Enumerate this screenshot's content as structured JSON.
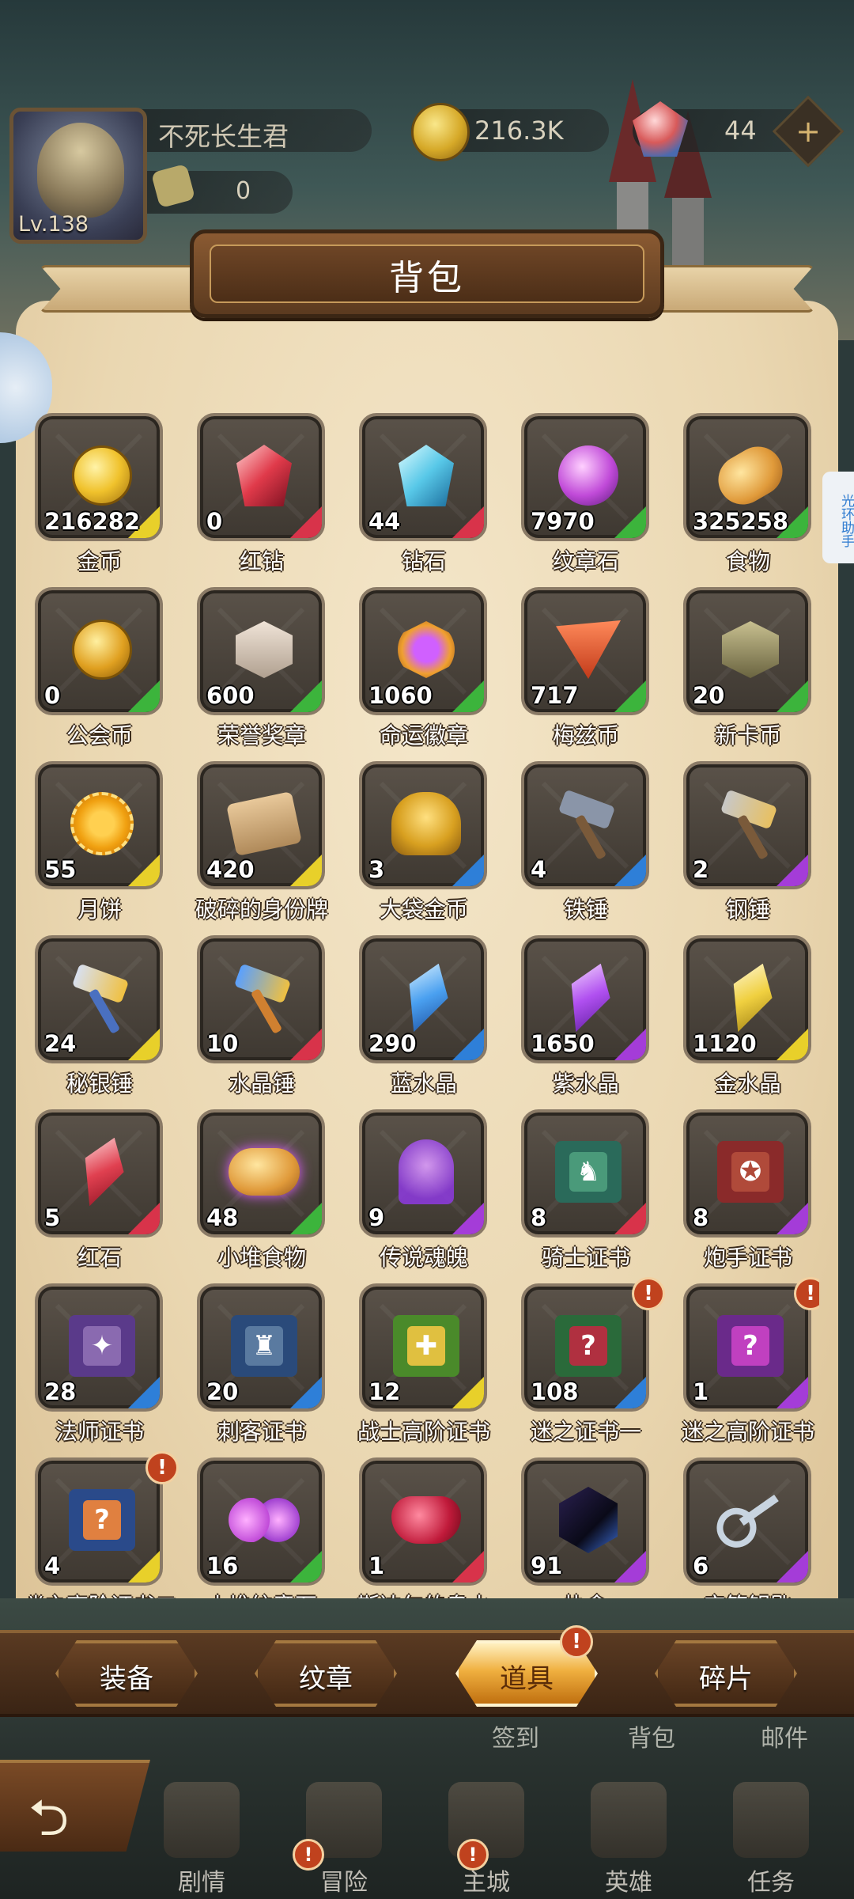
{
  "player": {
    "name": "不死长生君",
    "level": "Lv.138",
    "power": "0"
  },
  "currency": {
    "gold": "216.3K",
    "gems": "44",
    "add_symbol": "+"
  },
  "panel": {
    "title": "背包"
  },
  "helper_tab": "光环助手",
  "rarity_colors": {
    "yellow": "#e8d02a",
    "red": "#d8334a",
    "green": "#3cb43c",
    "blue": "#2e7fd8",
    "purple": "#a43cd8"
  },
  "items": [
    {
      "name": "金币",
      "count": "216282",
      "rarity": "yellow",
      "icon": "gold-coin-icon"
    },
    {
      "name": "红钻",
      "count": "0",
      "rarity": "red",
      "icon": "red-diamond-icon"
    },
    {
      "name": "钻石",
      "count": "44",
      "rarity": "red",
      "icon": "diamond-icon"
    },
    {
      "name": "纹章石",
      "count": "7970",
      "rarity": "green",
      "icon": "emblem-stone-icon"
    },
    {
      "name": "食物",
      "count": "325258",
      "rarity": "green",
      "icon": "bread-icon"
    },
    {
      "name": "公会币",
      "count": "0",
      "rarity": "green",
      "icon": "guild-coin-icon"
    },
    {
      "name": "荣誉奖章",
      "count": "600",
      "rarity": "green",
      "icon": "honor-medal-icon"
    },
    {
      "name": "命运徽章",
      "count": "1060",
      "rarity": "green",
      "icon": "fate-badge-icon"
    },
    {
      "name": "梅兹币",
      "count": "717",
      "rarity": "green",
      "icon": "mez-coin-icon"
    },
    {
      "name": "新卡币",
      "count": "20",
      "rarity": "green",
      "icon": "new-card-coin-icon"
    },
    {
      "name": "月饼",
      "count": "55",
      "rarity": "yellow",
      "icon": "mooncake-icon"
    },
    {
      "name": "破碎的身份牌",
      "count": "420",
      "rarity": "yellow",
      "icon": "broken-id-tag-icon"
    },
    {
      "name": "大袋金币",
      "count": "3",
      "rarity": "blue",
      "icon": "gold-bag-icon"
    },
    {
      "name": "铁锤",
      "count": "4",
      "rarity": "blue",
      "icon": "iron-hammer-icon"
    },
    {
      "name": "钢锤",
      "count": "2",
      "rarity": "purple",
      "icon": "steel-hammer-icon"
    },
    {
      "name": "秘银锤",
      "count": "24",
      "rarity": "yellow",
      "icon": "mithril-hammer-icon"
    },
    {
      "name": "水晶锤",
      "count": "10",
      "rarity": "red",
      "icon": "crystal-hammer-icon"
    },
    {
      "name": "蓝水晶",
      "count": "290",
      "rarity": "blue",
      "icon": "blue-crystal-icon"
    },
    {
      "name": "紫水晶",
      "count": "1650",
      "rarity": "purple",
      "icon": "purple-crystal-icon"
    },
    {
      "name": "金水晶",
      "count": "1120",
      "rarity": "yellow",
      "icon": "gold-crystal-icon"
    },
    {
      "name": "红石",
      "count": "5",
      "rarity": "red",
      "icon": "red-stone-icon"
    },
    {
      "name": "小堆食物",
      "count": "48",
      "rarity": "green",
      "icon": "food-pile-icon"
    },
    {
      "name": "传说魂魄",
      "count": "9",
      "rarity": "purple",
      "icon": "legend-soul-icon"
    },
    {
      "name": "骑士证书",
      "count": "8",
      "rarity": "red",
      "icon": "knight-certificate-icon"
    },
    {
      "name": "炮手证书",
      "count": "8",
      "rarity": "purple",
      "icon": "gunner-certificate-icon"
    },
    {
      "name": "法师证书",
      "count": "28",
      "rarity": "blue",
      "icon": "mage-certificate-icon"
    },
    {
      "name": "刺客证书",
      "count": "20",
      "rarity": "blue",
      "icon": "assassin-certificate-icon"
    },
    {
      "name": "战士高阶证书",
      "count": "12",
      "rarity": "yellow",
      "icon": "warrior-advanced-certificate-icon"
    },
    {
      "name": "迷之证书一",
      "count": "108",
      "rarity": "blue",
      "icon": "mystery-certificate-icon",
      "alert": "!"
    },
    {
      "name": "迷之高阶证书",
      "count": "1",
      "rarity": "purple",
      "icon": "mystery-advanced-certificate-icon",
      "alert": "!"
    },
    {
      "name": "迷之高阶证书二",
      "count": "4",
      "rarity": "yellow",
      "icon": "mystery-advanced-certificate-2-icon",
      "alert": "!"
    },
    {
      "name": "小堆纹章石",
      "count": "16",
      "rarity": "green",
      "icon": "emblem-stone-pile-icon"
    },
    {
      "name": "斯达尔的泉水",
      "count": "1",
      "rarity": "red",
      "icon": "magic-lamp-icon"
    },
    {
      "name": "执念",
      "count": "91",
      "rarity": "purple",
      "icon": "obsession-cube-icon"
    },
    {
      "name": "宝箱钥匙",
      "count": "6",
      "rarity": "purple",
      "icon": "chest-key-icon"
    }
  ],
  "tabs": [
    {
      "label": "装备",
      "active": false
    },
    {
      "label": "纹章",
      "active": false
    },
    {
      "label": "道具",
      "active": true,
      "alert": "!"
    },
    {
      "label": "碎片",
      "active": false
    }
  ],
  "behind_labels": [
    "签到",
    "背包",
    "邮件"
  ],
  "bottom_nav": [
    {
      "label": "剧情",
      "icon": "story-icon"
    },
    {
      "label": "冒险",
      "icon": "adventure-icon",
      "alert": "!"
    },
    {
      "label": "主城",
      "icon": "castle-icon",
      "alert": "!"
    },
    {
      "label": "英雄",
      "icon": "hero-helmet-icon"
    },
    {
      "label": "任务",
      "icon": "quest-scroll-icon"
    }
  ],
  "back_symbol": "⮌"
}
